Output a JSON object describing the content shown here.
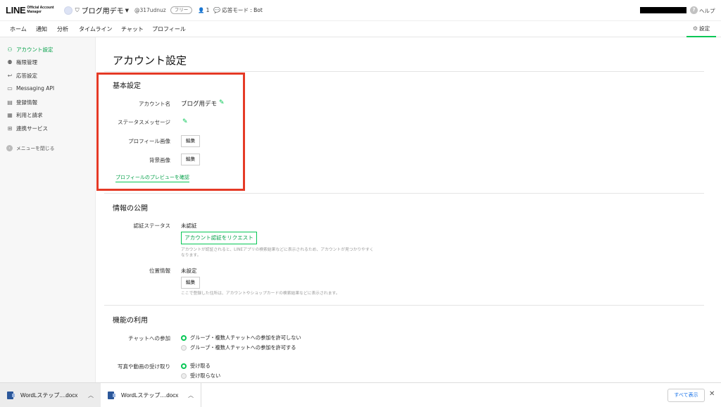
{
  "header": {
    "logo_main": "LINE",
    "logo_sub_1": "Official Account",
    "logo_sub_2": "Manager",
    "account_name": "ブログ用デモ",
    "account_id": "@317udnuz",
    "plan": "フリー",
    "member_count": "1",
    "mode": "応答モード : Bot",
    "help": "ヘルプ"
  },
  "nav": {
    "items": [
      "ホーム",
      "通知",
      "分析",
      "タイムライン",
      "チャット",
      "プロフィール"
    ],
    "settings": "設定"
  },
  "sidebar": {
    "items": [
      {
        "label": "アカウント設定",
        "icon": "user-icon"
      },
      {
        "label": "権限管理",
        "icon": "users-icon"
      },
      {
        "label": "応答設定",
        "icon": "reply-icon"
      },
      {
        "label": "Messaging API",
        "icon": "message-icon"
      },
      {
        "label": "登録情報",
        "icon": "document-icon"
      },
      {
        "label": "利用と請求",
        "icon": "invoice-icon"
      },
      {
        "label": "連携サービス",
        "icon": "link-service-icon"
      }
    ],
    "close": "メニューを閉じる"
  },
  "main": {
    "title": "アカウント設定",
    "basic": {
      "title": "基本設定",
      "account_name_label": "アカウント名",
      "account_name_value": "ブログ用デモ",
      "status_label": "ステータスメッセージ",
      "profile_image_label": "プロフィール画像",
      "background_label": "背景画像",
      "edit": "編集",
      "preview_link": "プロフィールのプレビューを確認"
    },
    "public": {
      "title": "情報の公開",
      "verify_label": "認証ステータス",
      "verify_value": "未認証",
      "verify_button": "アカウント認証をリクエスト",
      "verify_hint_1": "アカウントが認証されると、LINEアプリの検索結果などに表示されるため、アカウントが見つかりやすく",
      "verify_hint_2": "なります。",
      "location_label": "位置情報",
      "location_value": "未設定",
      "edit": "編集",
      "location_hint": "ここで登録した住所は、アカウントやショップカードの検索結果などに表示されます。"
    },
    "features": {
      "title": "機能の利用",
      "chat_label": "チャットへの参加",
      "chat_options": [
        "グループ・複数人チャットへの参加を許可しない",
        "グループ・複数人チャットへの参加を許可する"
      ],
      "media_label": "写真や動画の受け取り",
      "media_options": [
        "受け取る",
        "受け取らない"
      ]
    }
  },
  "downloads": {
    "items": [
      "WordLステップ....docx",
      "WordLステップ....docx"
    ],
    "show_all": "すべて表示"
  },
  "colors": {
    "accent": "#06c755",
    "highlight": "#e53a26"
  }
}
